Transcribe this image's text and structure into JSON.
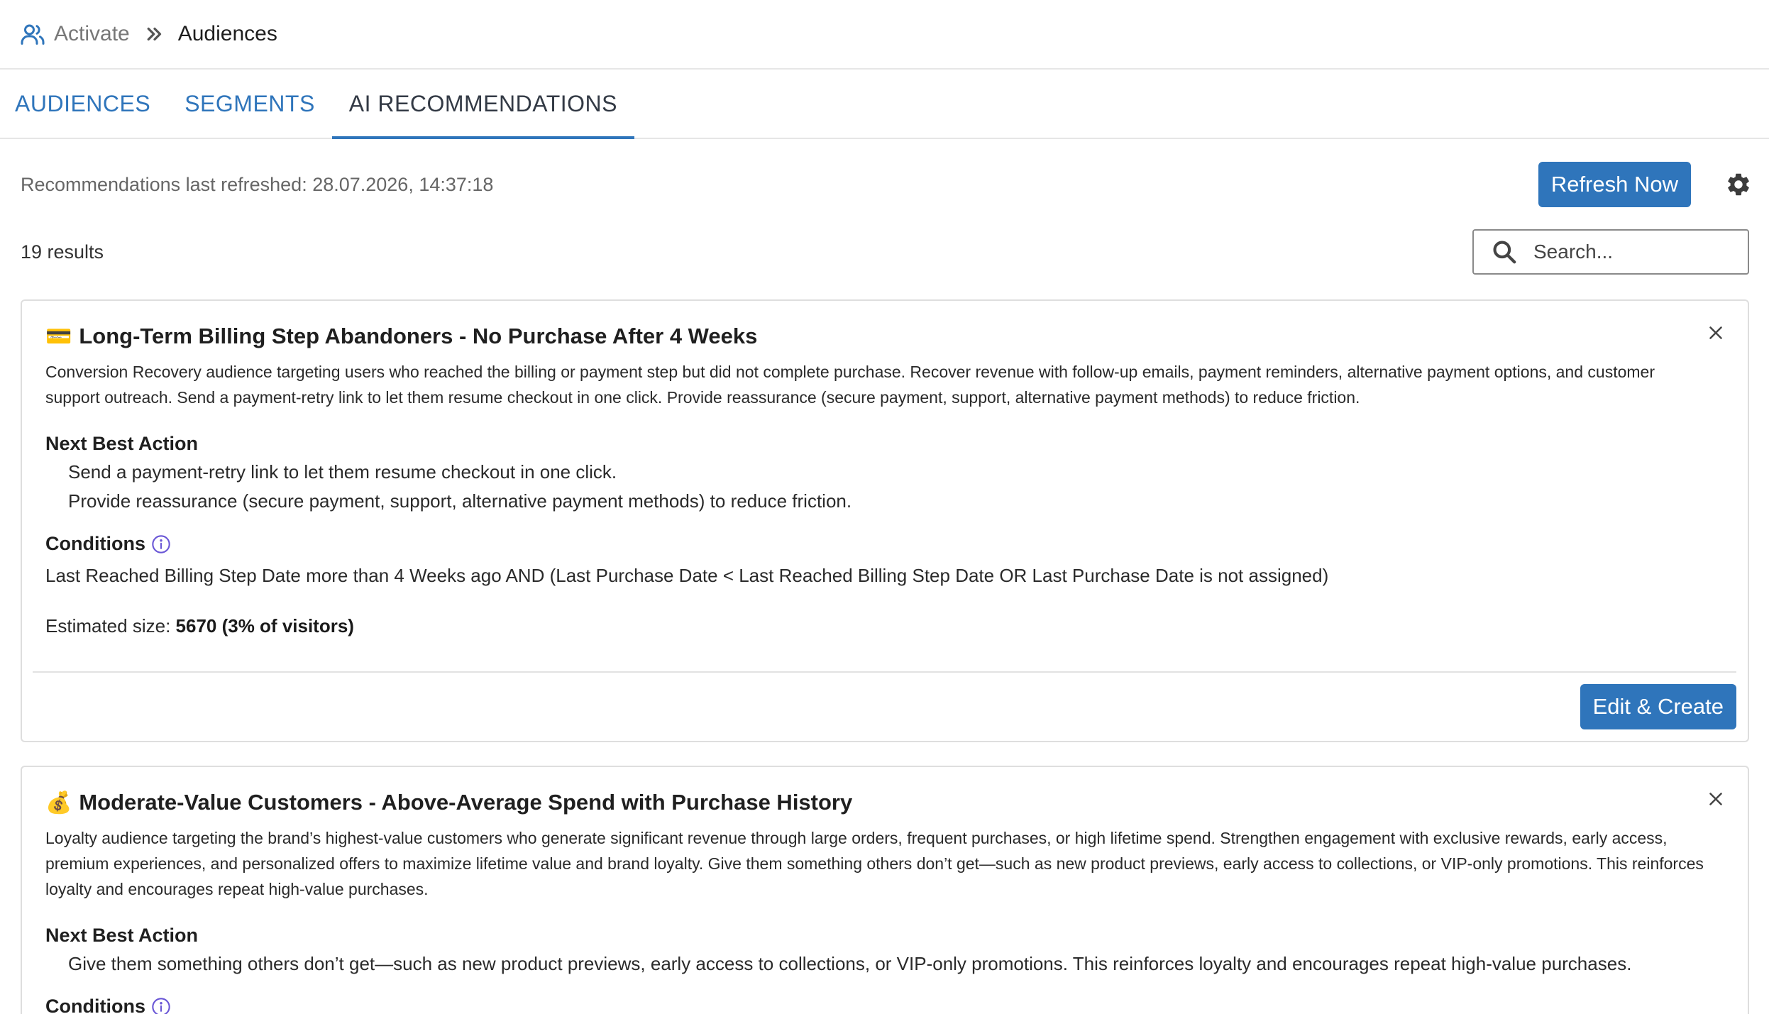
{
  "breadcrumb": {
    "root": "Activate",
    "current": "Audiences"
  },
  "tabs": [
    {
      "label": "AUDIENCES",
      "active": false
    },
    {
      "label": "SEGMENTS",
      "active": false
    },
    {
      "label": "AI RECOMMENDATIONS",
      "active": true
    }
  ],
  "meta": {
    "refreshed_text": "Recommendations last refreshed: 28.07.2026, 14:37:18",
    "refresh_button": "Refresh Now"
  },
  "results": {
    "count_text": "19 results",
    "search_placeholder": "Search..."
  },
  "colors": {
    "accent": "#2f75bb",
    "info_icon": "#6a57d6"
  },
  "cards": [
    {
      "emoji": "💳",
      "title": "Long-Term Billing Step Abandoners - No Purchase After 4 Weeks",
      "description": "Conversion Recovery audience targeting users who reached the billing or payment step but did not complete purchase. Recover revenue with follow-up emails, payment reminders, alternative payment options, and customer support outreach. Send a payment-retry link to let them resume checkout in one click. Provide reassurance (secure payment, support, alternative payment methods) to reduce friction.",
      "next_best_action_label": "Next Best Action",
      "actions": [
        "Send a payment-retry link to let them resume checkout in one click.",
        "Provide reassurance (secure payment, support, alternative payment methods) to reduce friction."
      ],
      "conditions_label": "Conditions",
      "conditions": "Last Reached Billing Step Date more than 4 Weeks ago AND (Last Purchase Date < Last Reached Billing Step Date OR Last Purchase Date is not assigned)",
      "estimate_label": "Estimated size:",
      "estimate_value": "5670 (3% of visitors)",
      "button": "Edit & Create"
    },
    {
      "emoji": "💰",
      "title": "Moderate-Value Customers - Above-Average Spend with Purchase History",
      "description": "Loyalty audience targeting the brand’s highest-value customers who generate significant revenue through large orders, frequent purchases, or high lifetime spend. Strengthen engagement with exclusive rewards, early access, premium experiences, and personalized offers to maximize lifetime value and brand loyalty. Give them something others don’t get—such as new product previews, early access to collections, or VIP-only promotions. This reinforces loyalty and encourages repeat high-value purchases.",
      "next_best_action_label": "Next Best Action",
      "actions": [
        "Give them something others don’t get—such as new product previews, early access to collections, or VIP-only promotions. This reinforces loyalty and encourages repeat high-value purchases."
      ],
      "conditions_label": "Conditions"
    }
  ]
}
